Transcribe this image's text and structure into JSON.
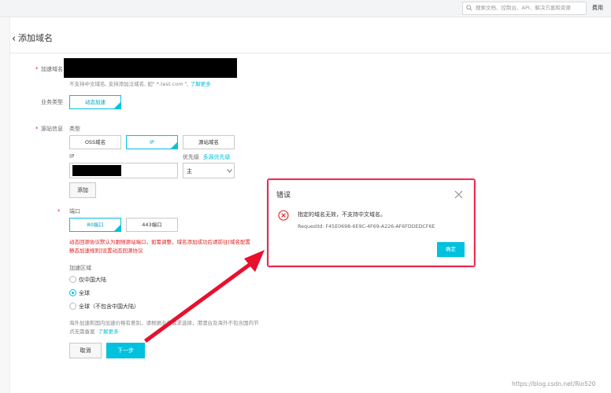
{
  "topbar": {
    "search_placeholder": "搜索文档、控制台、API、解决方案和资源",
    "fee_label": "费用"
  },
  "header": {
    "back_icon": "chevron-left-icon",
    "title": "添加域名"
  },
  "form": {
    "domain": {
      "label": "加速域名",
      "hint": "不支持中文域名, 支持添加泛域名, 如\" *.test.com \", ",
      "hint_link": "了解更多"
    },
    "business_type": {
      "label": "业务类型",
      "option": "动态加速"
    },
    "origin": {
      "label": "源站信息",
      "type_label": "类型",
      "types": [
        "OSS域名",
        "IP",
        "源站域名"
      ],
      "selected_type": "IP",
      "ip_label": "IP",
      "priority_label": "优先级",
      "priority_link": "多源优先级",
      "priority_value": "主",
      "add_button": "添加"
    },
    "port": {
      "label": "端口",
      "options": [
        "80端口",
        "443端口"
      ],
      "selected": "80端口",
      "warning_line1": "动态回源协议默认为跟随源站端口，如需调整，域名添加成功后请前往[域名配置",
      "warning_line2": "静态加速规则]设置动态回源协议"
    },
    "region": {
      "label": "加速区域",
      "options": [
        "仅中国大陆",
        "全球",
        "全球（不包含中国大陆）"
      ],
      "selected": "全球",
      "note_line1": "海外加速和国内加速价格有差别，请根据业务需求选择，港澳台及海外不包含国内节",
      "note_line2": "点无需备案",
      "note_link": "了解更多"
    },
    "cancel_button": "取消",
    "next_button": "下一步"
  },
  "modal": {
    "title": "错误",
    "message": "指定的域名无效，不支持中文域名。",
    "request_id": "RequestId: F45E0698-6E9C-4F69-A226-AF6FDDEDCF6E",
    "ok_button": "确定",
    "error_icon": "error-circle-icon",
    "close_icon": "close-icon"
  },
  "annotation": {
    "frame_color": "#ff2d55",
    "arrow_color": "#e8102e"
  },
  "colors": {
    "accent": "#00c1de",
    "error": "#e02020"
  },
  "watermark": "https://blog.csdn.net/Rio520"
}
